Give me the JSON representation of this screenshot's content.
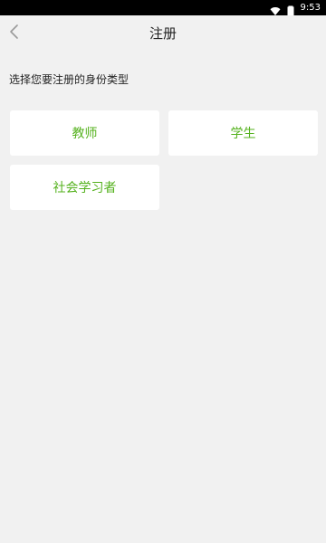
{
  "status_bar": {
    "time": "9:53"
  },
  "header": {
    "title": "注册",
    "back_icon": "chevron-left-icon"
  },
  "prompt": "选择您要注册的身份类型",
  "roles": [
    {
      "label": "教师"
    },
    {
      "label": "学生"
    },
    {
      "label": "社会学习者"
    }
  ],
  "colors": {
    "accent": "#55b21e",
    "background": "#f1f1f1",
    "card": "#ffffff"
  }
}
